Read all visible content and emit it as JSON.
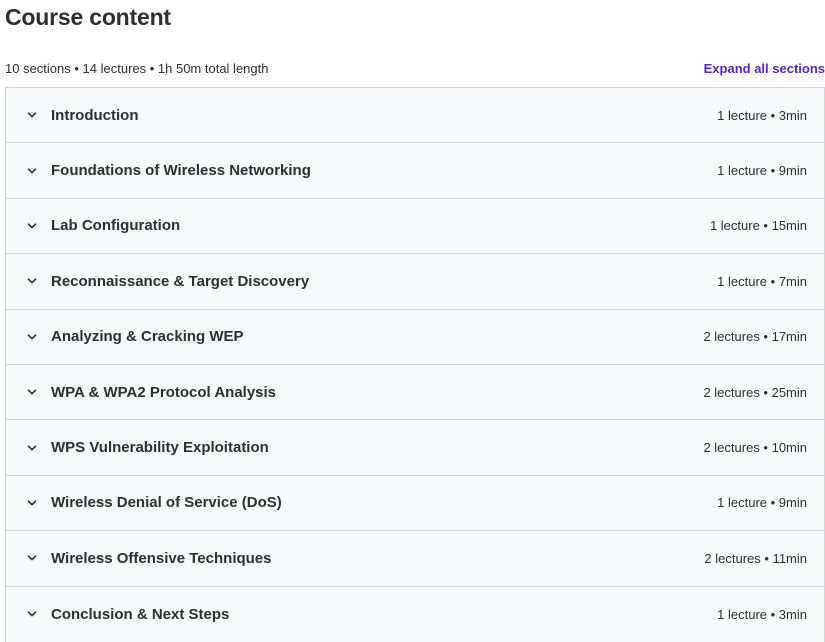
{
  "header": {
    "title": "Course content",
    "summary": "10 sections • 14 lectures • 1h 50m total length",
    "expand_all_label": "Expand all sections"
  },
  "colors": {
    "accent": "#5624d0",
    "row_background": "#f7f9fa",
    "border": "#d1d7dc"
  },
  "sections": [
    {
      "title": "Introduction",
      "meta": "1 lecture • 3min",
      "icon": "chevron-down-icon"
    },
    {
      "title": "Foundations of Wireless Networking",
      "meta": "1 lecture • 9min",
      "icon": "chevron-down-icon"
    },
    {
      "title": "Lab Configuration",
      "meta": "1 lecture • 15min",
      "icon": "chevron-down-icon"
    },
    {
      "title": "Reconnaissance & Target Discovery",
      "meta": "1 lecture • 7min",
      "icon": "chevron-down-icon"
    },
    {
      "title": "Analyzing & Cracking WEP",
      "meta": "2 lectures • 17min",
      "icon": "chevron-down-icon"
    },
    {
      "title": "WPA & WPA2 Protocol Analysis",
      "meta": "2 lectures • 25min",
      "icon": "chevron-down-icon"
    },
    {
      "title": "WPS Vulnerability Exploitation",
      "meta": "2 lectures • 10min",
      "icon": "chevron-down-icon"
    },
    {
      "title": "Wireless Denial of Service (DoS)",
      "meta": "1 lecture • 9min",
      "icon": "chevron-down-icon"
    },
    {
      "title": "Wireless Offensive Techniques",
      "meta": "2 lectures • 11min",
      "icon": "chevron-down-icon"
    },
    {
      "title": "Conclusion & Next Steps",
      "meta": "1 lecture • 3min",
      "icon": "chevron-down-icon"
    }
  ]
}
